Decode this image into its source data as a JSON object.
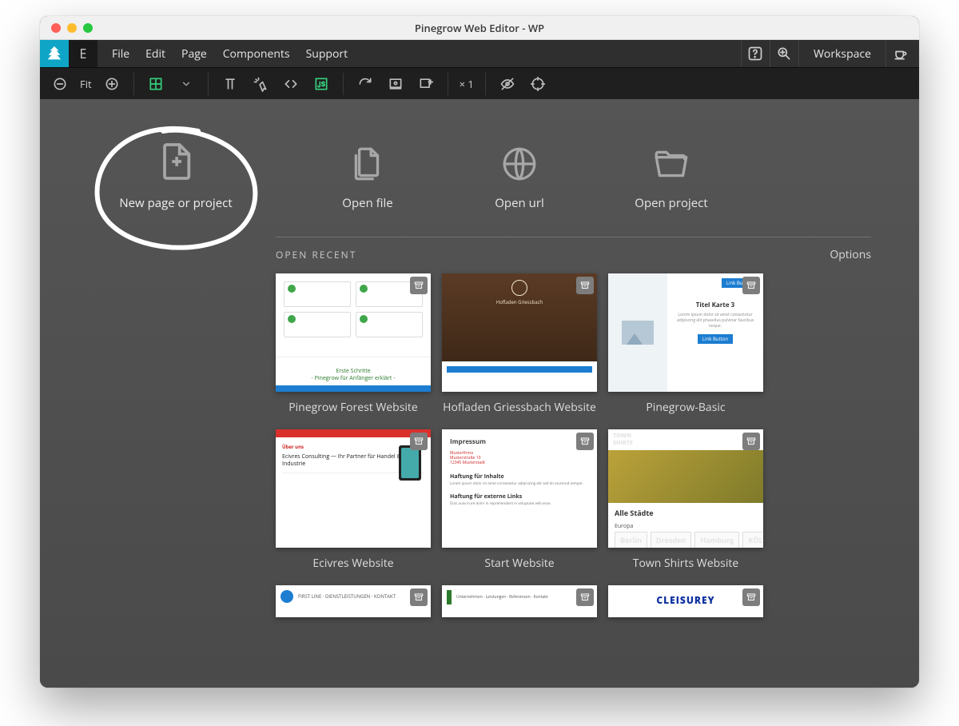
{
  "window": {
    "title": "Pinegrow Web Editor - WP"
  },
  "menubar": {
    "brand_letter": "E",
    "items": [
      "File",
      "Edit",
      "Page",
      "Components",
      "Support"
    ],
    "workspace_label": "Workspace"
  },
  "toolbar": {
    "fit_label": "Fit",
    "multiplier_label": "× 1"
  },
  "start": {
    "new_page_label": "New page or project",
    "open_file_label": "Open file",
    "open_url_label": "Open url",
    "open_project_label": "Open project"
  },
  "recent": {
    "title": "OPEN RECENT",
    "options_label": "Options",
    "items": [
      {
        "label": "Pinegrow Forest Website"
      },
      {
        "label": "Hofladen Griessbach Website"
      },
      {
        "label": "Pinegrow-Basic"
      },
      {
        "label": "Ecivres Website"
      },
      {
        "label": "Start Website"
      },
      {
        "label": "Town Shirts Website"
      }
    ],
    "row3": [
      {
        "label": ""
      },
      {
        "label": ""
      },
      {
        "label": ""
      }
    ]
  },
  "thumb_text": {
    "t1_line1": "Erste Schritte",
    "t1_line2": "- Pinegrow für Anfänger erklärt -",
    "t3_title": "Titel Karte 3",
    "t3_btn": "Link Button",
    "t4_line": "Ecivres Consulting — Ihr Partner für Handel & Industrie",
    "t5_h": "Impressum",
    "t5_a": "Haftung für Inhalte",
    "t5_b": "Haftung für externe Links",
    "t6_all": "Alle Städte",
    "t6_eu": "Europa",
    "cities": [
      "Berlin",
      "Dresden",
      "Hamburg",
      "KÖLN"
    ],
    "leisurey": "CLEISUREY"
  }
}
